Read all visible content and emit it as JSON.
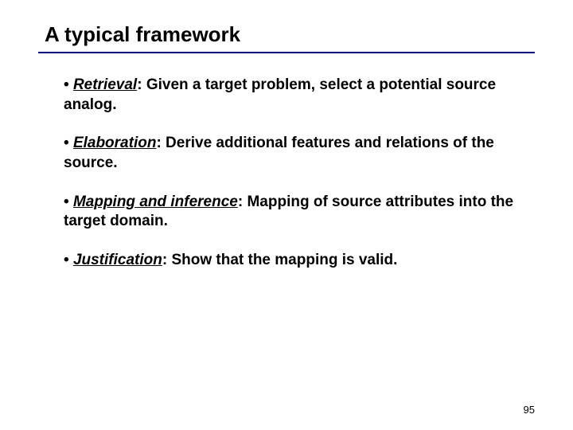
{
  "title": "A typical framework",
  "items": [
    {
      "term": "Retrieval",
      "desc": ": Given a target problem, select a potential source analog."
    },
    {
      "term": "Elaboration",
      "desc": ": Derive additional features and relations of the source."
    },
    {
      "term": "Mapping and inference",
      "desc": ": Mapping of source attributes into the target domain."
    },
    {
      "term": "Justification",
      "desc": ": Show that the mapping is valid."
    }
  ],
  "page_number": "95"
}
